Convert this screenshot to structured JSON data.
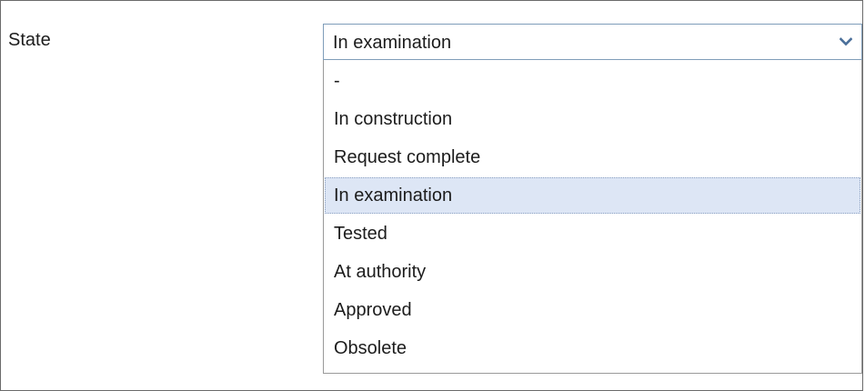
{
  "form": {
    "state_label": "State",
    "state_value": "In examination"
  },
  "dropdown": {
    "arrow_icon": "chevron-down-icon",
    "selected_index": 3,
    "options": [
      "-",
      "In construction",
      "Request complete",
      "In examination",
      "Tested",
      "At authority",
      "Approved",
      "Obsolete"
    ]
  },
  "colors": {
    "selection_background": "#dde6f5",
    "combo_border": "#7f9db9",
    "arrow": "#4a6f9a"
  }
}
